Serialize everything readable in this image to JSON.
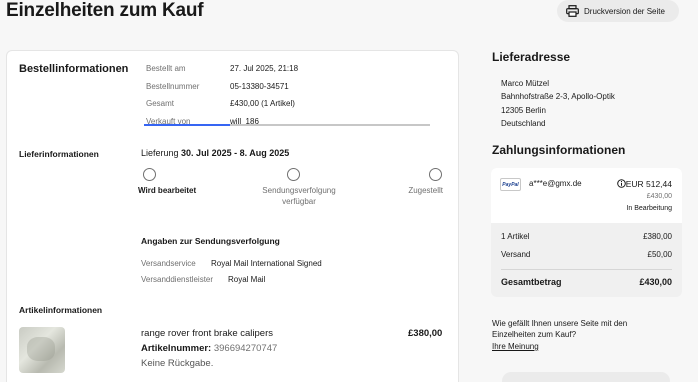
{
  "page_title": "Einzelheiten zum Kauf",
  "print_button": {
    "label": "Druckversion der Seite",
    "icon": "printer-icon"
  },
  "order_info": {
    "heading": "Bestellinformationen",
    "rows": [
      {
        "label": "Bestellt am",
        "value": "27. Jul 2025, 21:18"
      },
      {
        "label": "Bestellnummer",
        "value": "05-13380-34571"
      },
      {
        "label": "Gesamt",
        "value": "£430,00 (1 Artikel)"
      },
      {
        "label": "Verkauft von",
        "value": "will_186"
      }
    ]
  },
  "delivery_info": {
    "heading": "Lieferinformationen",
    "prefix": "Lieferung",
    "date_range": "30. Jul 2025 - 8. Aug 2025",
    "steps": [
      {
        "label": "Wird bearbeitet",
        "active": true
      },
      {
        "label_line1": "Sendungsverfolgung",
        "label_line2": "verfügbar",
        "active": false
      },
      {
        "label": "Zugestellt",
        "active": false
      }
    ],
    "accent_color": "#3665f3"
  },
  "tracking": {
    "heading": "Angaben zur Sendungsverfolgung",
    "service_label": "Versandservice",
    "service_value": "Royal Mail International Signed",
    "provider_label": "Versanddienstleister",
    "provider_value": "Royal Mail"
  },
  "item_info": {
    "heading": "Artikelinformationen",
    "title": "range rover front brake calipers",
    "number_label": "Artikelnummer:",
    "number_value": "396694270747",
    "returns": "Keine Rückgabe.",
    "price": "£380,00"
  },
  "shipping_address": {
    "heading": "Lieferadresse",
    "lines": [
      "Marco Mützel",
      "Bahnhofstraße 2-3, Apollo-Optik",
      "12305 Berlin",
      "Deutschland"
    ]
  },
  "payment_info": {
    "heading": "Zahlungsinformationen",
    "method_badge": "PayPal",
    "account": "a***e@gmx.de",
    "amount": "EUR 512,44",
    "amount_gbp": "£430,00",
    "status": "In Bearbeitung",
    "info_icon": "info-icon"
  },
  "summary": {
    "items_label": "1 Artikel",
    "items_value": "£380,00",
    "shipping_label": "Versand",
    "shipping_value": "£50,00",
    "total_label": "Gesamtbetrag",
    "total_value": "£430,00"
  },
  "feedback": {
    "question": "Wie gefällt Ihnen unsere Seite mit den Einzelheiten zum Kauf?",
    "link": "Ihre Meinung"
  }
}
